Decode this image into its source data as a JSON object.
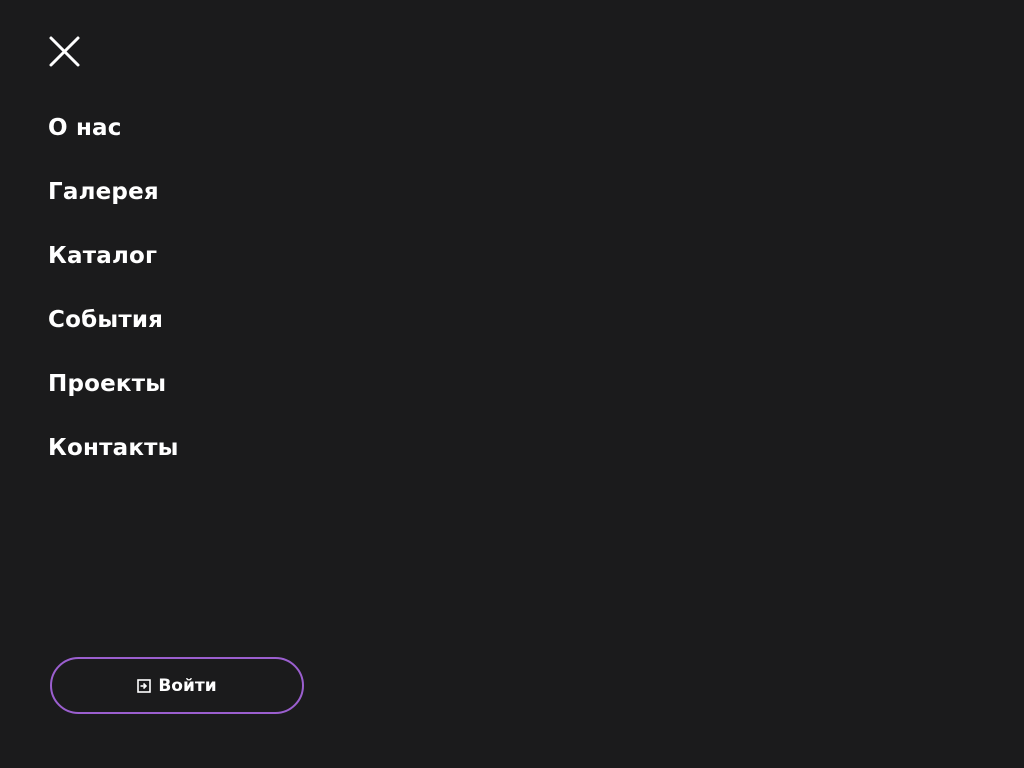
{
  "menu": {
    "close_icon": "close-icon",
    "items": [
      {
        "label": "О нас"
      },
      {
        "label": "Галерея"
      },
      {
        "label": "Каталог"
      },
      {
        "label": "События"
      },
      {
        "label": "Проекты"
      },
      {
        "label": "Контакты"
      }
    ]
  },
  "login": {
    "icon": "login-icon",
    "label": "Войти"
  },
  "colors": {
    "background": "#1b1b1c",
    "text": "#ffffff",
    "accent": "#9b5fcf"
  }
}
